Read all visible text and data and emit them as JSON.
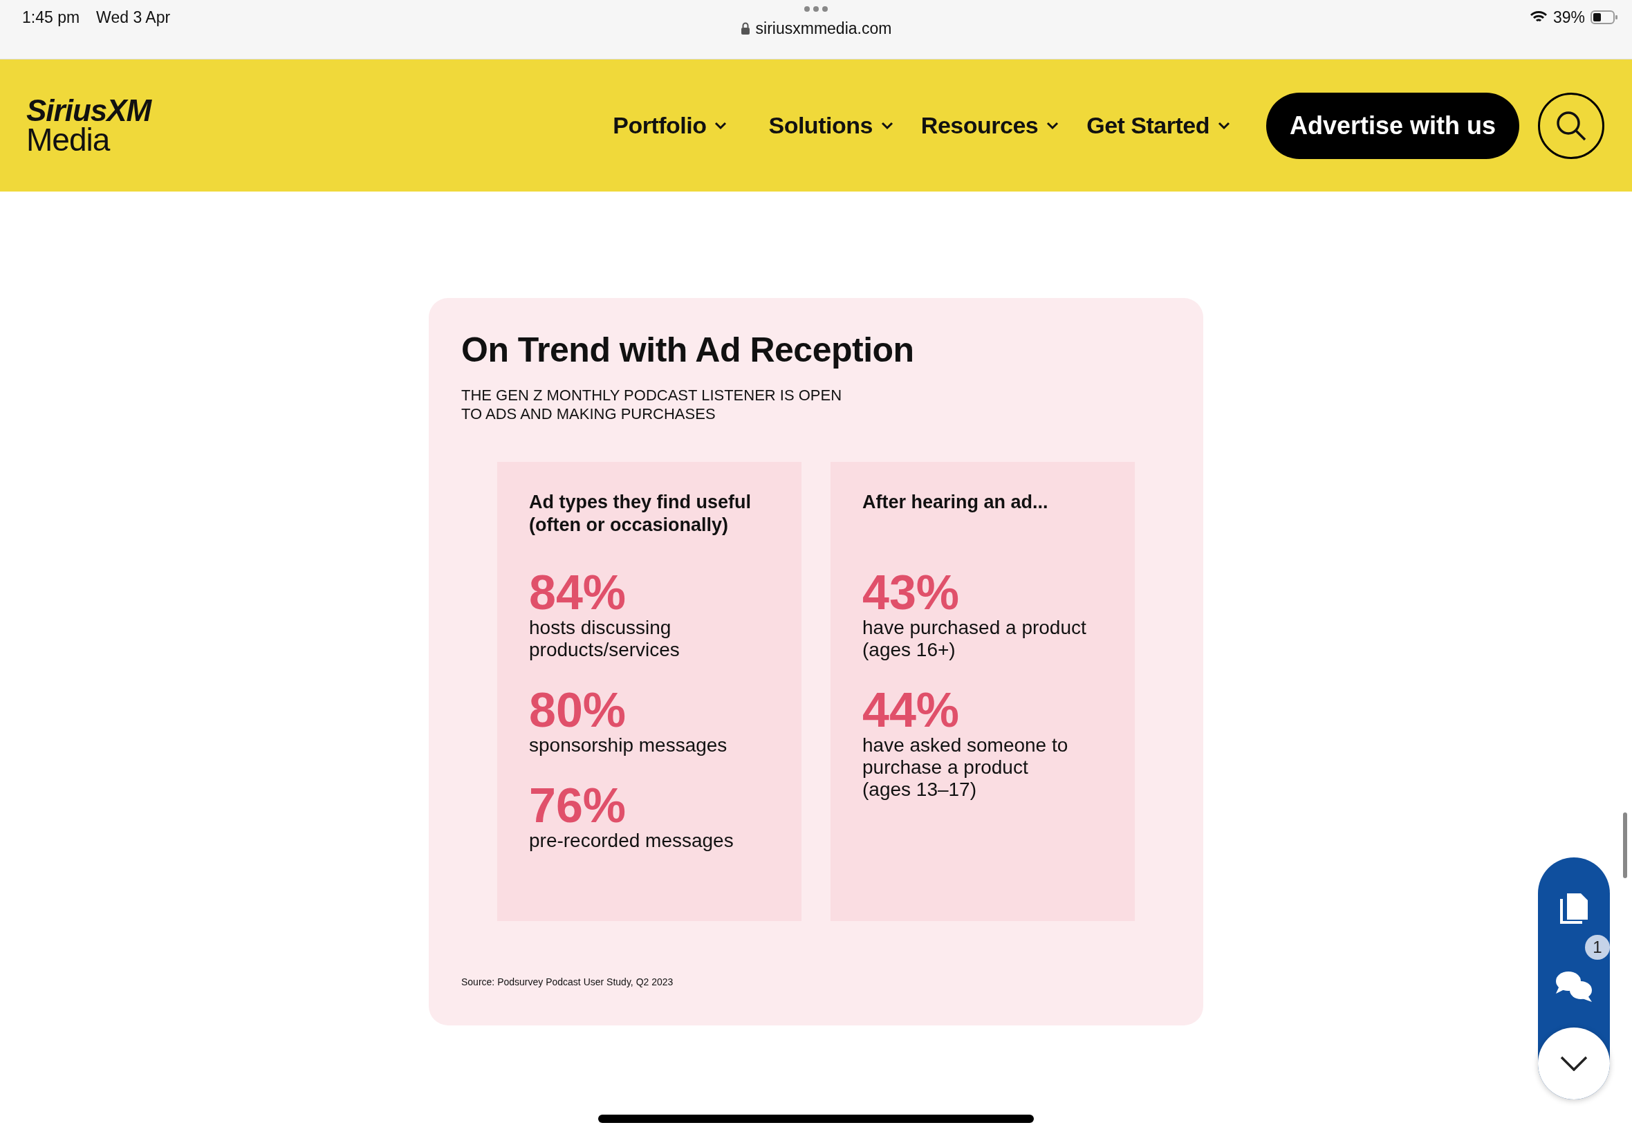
{
  "status_bar": {
    "time": "1:45 pm",
    "date": "Wed 3 Apr",
    "url": "siriusxmmedia.com",
    "battery": "39%"
  },
  "header": {
    "logo": [
      "SiriusXM",
      "Media"
    ],
    "nav": [
      {
        "label": "Portfolio"
      },
      {
        "label": "Solutions"
      },
      {
        "label": "Resources"
      },
      {
        "label": "Get Started"
      }
    ],
    "cta": "Advertise with us"
  },
  "card": {
    "title": "On Trend with Ad Reception",
    "subtitle": [
      "THE GEN Z MONTHLY PODCAST LISTENER IS OPEN",
      "TO ADS AND MAKING PURCHASES"
    ],
    "columns": [
      {
        "heading": [
          "Ad types they find useful",
          "(often or occasionally)"
        ],
        "stats": [
          {
            "value": "84%",
            "caption": [
              "hosts discussing",
              "products/services"
            ]
          },
          {
            "value": "80%",
            "caption": [
              "sponsorship messages"
            ]
          },
          {
            "value": "76%",
            "caption": [
              "pre-recorded messages"
            ]
          }
        ]
      },
      {
        "heading": [
          "After hearing an ad..."
        ],
        "stats": [
          {
            "value": "43%",
            "caption": [
              "have purchased a product",
              "(ages 16+)"
            ]
          },
          {
            "value": "44%",
            "caption": [
              "have asked someone to",
              "purchase a product",
              "(ages 13–17)"
            ]
          }
        ]
      }
    ],
    "source": "Source: Podsurvey Podcast User Study, Q2 2023"
  },
  "widget": {
    "badge": "1"
  }
}
